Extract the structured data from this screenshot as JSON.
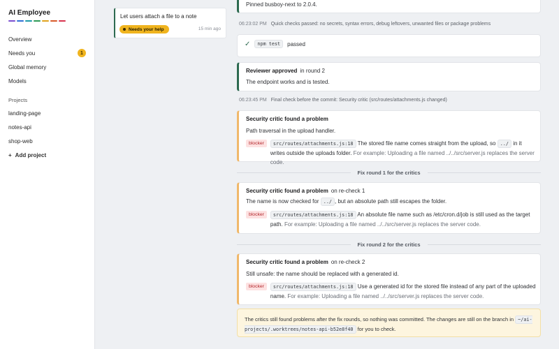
{
  "app": {
    "title": "AI Employee",
    "brand_colors": [
      "#7a4fd0",
      "#2f6fd6",
      "#1e9aa8",
      "#2e9a55",
      "#e0a21e",
      "#d85a2a",
      "#d8344f"
    ]
  },
  "nav": {
    "items": [
      {
        "label": "Overview"
      },
      {
        "label": "Needs you",
        "count": "1"
      },
      {
        "label": "Global memory"
      },
      {
        "label": "Models"
      }
    ]
  },
  "projects": {
    "heading": "Projects",
    "items": [
      {
        "label": "landing-page"
      },
      {
        "label": "notes-api"
      },
      {
        "label": "shop-web"
      }
    ],
    "add_label": "Add project",
    "add_icon": "+"
  },
  "task": {
    "title": "Let users attach a file to a note",
    "badge": "Needs your help",
    "time": "15 min ago"
  },
  "feed": {
    "pinned_text": "Pinned busboy-next to 2.0.4.",
    "log1": {
      "time": "06:23:02 PM",
      "text": "Quick checks passed: no secrets, syntax errors, debug leftovers, unwanted files or package problems"
    },
    "test": {
      "icon": "✓",
      "command": "npm test",
      "result": "passed"
    },
    "reviewer": {
      "title": "Reviewer approved",
      "sub": "in round 2",
      "text": "The endpoint works and is tested."
    },
    "log2": {
      "time": "06:23:45 PM",
      "text": "Final check before the commit: Security critic (src/routes/attachments.js changed)"
    },
    "critic1": {
      "title": "Security critic found a problem",
      "sub": "",
      "text": "Path traversal in the upload handler.",
      "tag": "blocker",
      "file": "src/routes/attachments.js:18",
      "detail_before": "The stored file name comes straight from the upload, so",
      "detail_code": "../",
      "detail_after": "in it writes outside the uploads folder.",
      "example": "For example: Uploading a file named ../../src/server.js replaces the server code."
    },
    "divider1": "Fix round 1 for the critics",
    "critic2": {
      "title": "Security critic found a problem",
      "sub": "on re-check 1",
      "text_before": "The name is now checked for",
      "text_code": "../",
      "text_after": ", but an absolute path still escapes the folder.",
      "tag": "blocker",
      "file": "src/routes/attachments.js:18",
      "detail": "An absolute file name such as /etc/cron.d/job is still used as the target path.",
      "example": "For example: Uploading a file named ../../src/server.js replaces the server code."
    },
    "divider2": "Fix round 2 for the critics",
    "critic3": {
      "title": "Security critic found a problem",
      "sub": "on re-check 2",
      "text": "Still unsafe: the name should be replaced with a generated id.",
      "tag": "blocker",
      "file": "src/routes/attachments.js:18",
      "detail": "Use a generated id for the stored file instead of any part of the uploaded name.",
      "example": "For example: Uploading a file named ../../src/server.js replaces the server code."
    },
    "notice": {
      "text": "The critics still found problems after the fix rounds, so nothing was committed. The changes are still on the branch in",
      "branch": "~/ai-projects/.worktrees/notes-api-b52e8f40",
      "after": "for you to check."
    }
  }
}
